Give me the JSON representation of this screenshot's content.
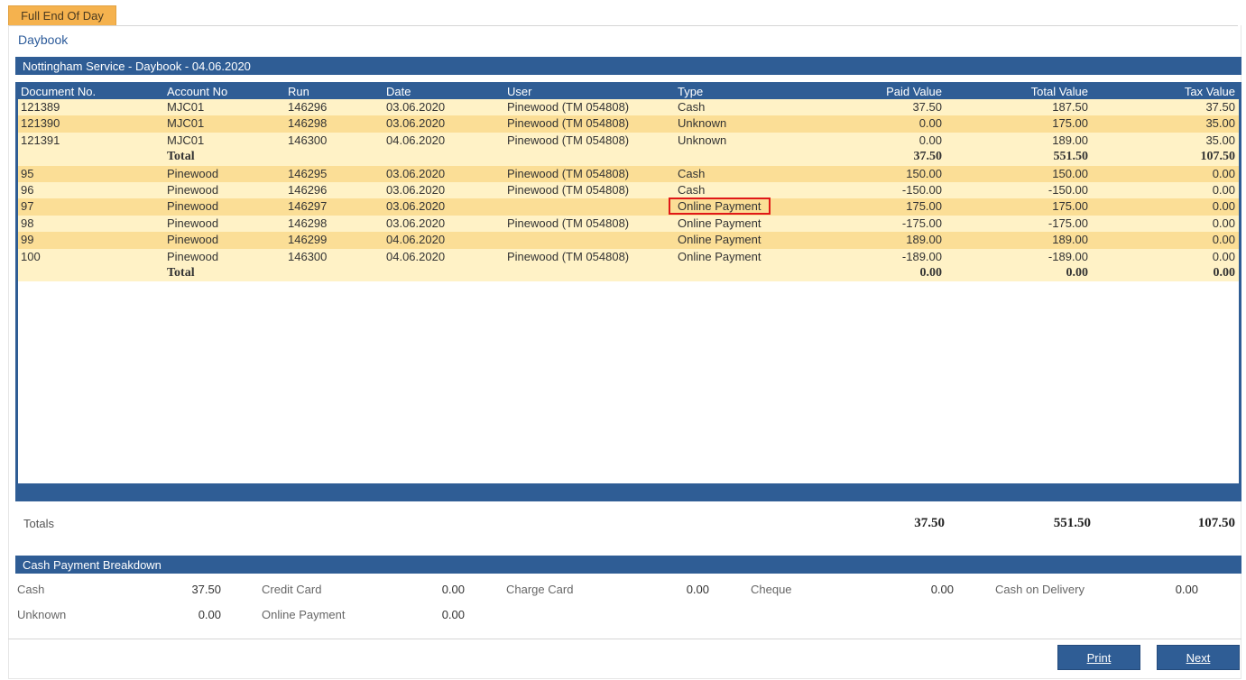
{
  "tab": {
    "label": "Full End Of Day"
  },
  "page": {
    "title": "Daybook"
  },
  "daybook": {
    "section_title": "Nottingham Service - Daybook - 04.06.2020",
    "columns": [
      "Document No.",
      "Account No",
      "Run",
      "Date",
      "User",
      "Type",
      "Paid Value",
      "Total Value",
      "Tax Value"
    ],
    "rows": [
      {
        "doc": "121389",
        "acc": "MJC01",
        "run": "146296",
        "date": "03.06.2020",
        "user": "Pinewood (TM 054808)",
        "type": "Cash",
        "paid": "37.50",
        "total": "187.50",
        "tax": "37.50"
      },
      {
        "doc": "121390",
        "acc": "MJC01",
        "run": "146298",
        "date": "03.06.2020",
        "user": "Pinewood (TM 054808)",
        "type": "Unknown",
        "paid": "0.00",
        "total": "175.00",
        "tax": "35.00"
      },
      {
        "doc": "121391",
        "acc": "MJC01",
        "run": "146300",
        "date": "04.06.2020",
        "user": "Pinewood (TM 054808)",
        "type": "Unknown",
        "paid": "0.00",
        "total": "189.00",
        "tax": "35.00"
      },
      {
        "acc": "Total",
        "paid": "37.50",
        "total": "551.50",
        "tax": "107.50",
        "is_total": true
      },
      {
        "doc": "95",
        "acc": "Pinewood",
        "run": "146295",
        "date": "03.06.2020",
        "user": "Pinewood (TM 054808)",
        "type": "Cash",
        "paid": "150.00",
        "total": "150.00",
        "tax": "0.00"
      },
      {
        "doc": "96",
        "acc": "Pinewood",
        "run": "146296",
        "date": "03.06.2020",
        "user": "Pinewood (TM 054808)",
        "type": "Cash",
        "paid": "-150.00",
        "total": "-150.00",
        "tax": "0.00"
      },
      {
        "doc": "97",
        "acc": "Pinewood",
        "run": "146297",
        "date": "03.06.2020",
        "user": "",
        "type": "Online Payment",
        "paid": "175.00",
        "total": "175.00",
        "tax": "0.00",
        "highlight": true
      },
      {
        "doc": "98",
        "acc": "Pinewood",
        "run": "146298",
        "date": "03.06.2020",
        "user": "Pinewood (TM 054808)",
        "type": "Online Payment",
        "paid": "-175.00",
        "total": "-175.00",
        "tax": "0.00"
      },
      {
        "doc": "99",
        "acc": "Pinewood",
        "run": "146299",
        "date": "04.06.2020",
        "user": "",
        "type": "Online Payment",
        "paid": "189.00",
        "total": "189.00",
        "tax": "0.00"
      },
      {
        "doc": "100",
        "acc": "Pinewood",
        "run": "146300",
        "date": "04.06.2020",
        "user": "Pinewood (TM 054808)",
        "type": "Online Payment",
        "paid": "-189.00",
        "total": "-189.00",
        "tax": "0.00"
      },
      {
        "acc": "Total",
        "paid": "0.00",
        "total": "0.00",
        "tax": "0.00",
        "is_total": true
      }
    ]
  },
  "totals": {
    "label": "Totals",
    "paid": "37.50",
    "total": "551.50",
    "tax": "107.50"
  },
  "breakdown": {
    "title": "Cash Payment Breakdown",
    "cash_label": "Cash",
    "cash_value": "37.50",
    "credit_label": "Credit Card",
    "credit_value": "0.00",
    "charge_label": "Charge Card",
    "charge_value": "0.00",
    "cheque_label": "Cheque",
    "cheque_value": "0.00",
    "cod_label": "Cash on Delivery",
    "cod_value": "0.00",
    "unknown_label": "Unknown",
    "unknown_value": "0.00",
    "online_label": "Online Payment",
    "online_value": "0.00"
  },
  "buttons": {
    "print": "Print",
    "next": "Next"
  },
  "colors": {
    "accent": "#2f5d95",
    "tab": "#f5b24e",
    "row_light": "#fff2c6",
    "row_dark": "#fbde96",
    "highlight": "#e01818"
  }
}
